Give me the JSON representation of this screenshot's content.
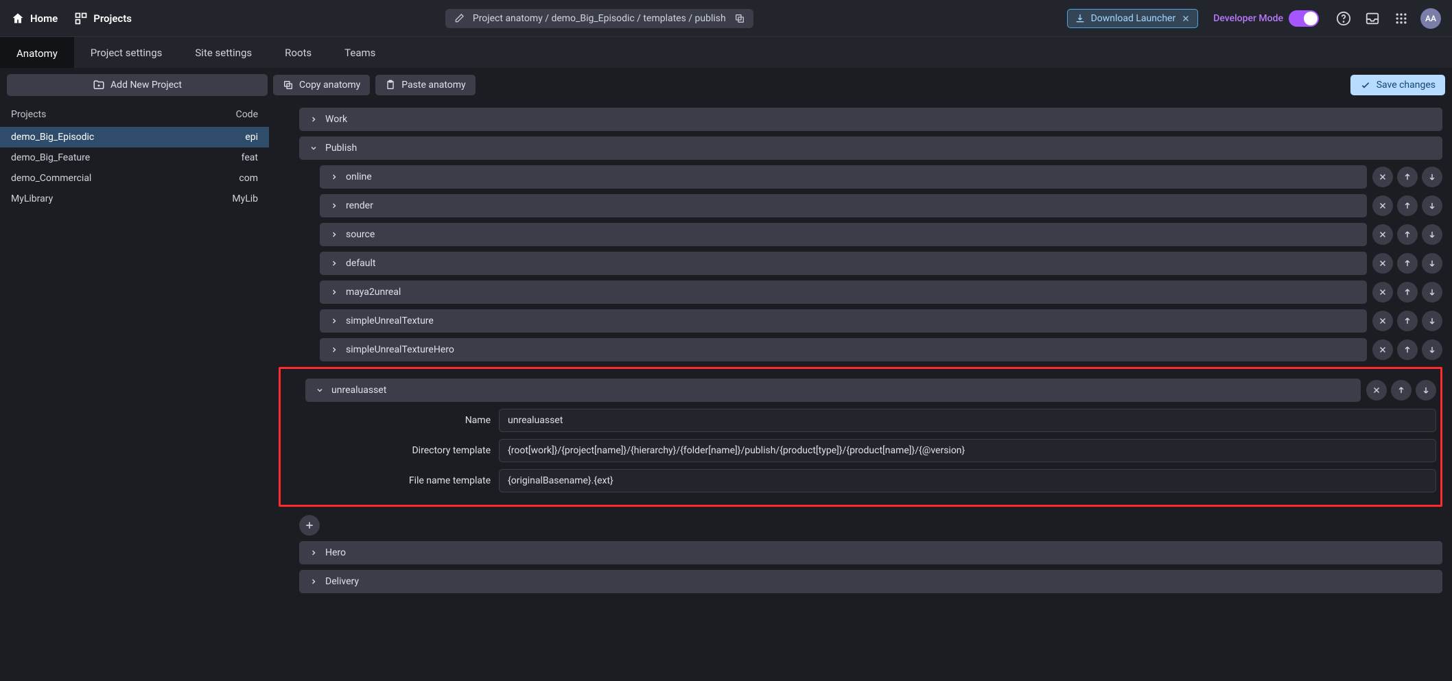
{
  "topbar": {
    "home": "Home",
    "projects": "Projects",
    "breadcrumb": "Project anatomy / demo_Big_Episodic / templates / publish",
    "download_launcher": "Download Launcher",
    "developer_mode": "Developer Mode",
    "avatar": "AA"
  },
  "tabs": {
    "anatomy": "Anatomy",
    "project_settings": "Project settings",
    "site_settings": "Site settings",
    "roots": "Roots",
    "teams": "Teams"
  },
  "toolbar": {
    "add_new_project": "Add New Project",
    "copy_anatomy": "Copy anatomy",
    "paste_anatomy": "Paste anatomy",
    "save_changes": "Save changes"
  },
  "sidebar": {
    "projects_label": "Projects",
    "code_label": "Code",
    "items": [
      {
        "name": "demo_Big_Episodic",
        "code": "epi",
        "active": true
      },
      {
        "name": "demo_Big_Feature",
        "code": "feat",
        "active": false
      },
      {
        "name": "demo_Commercial",
        "code": "com",
        "active": false
      },
      {
        "name": "MyLibrary",
        "code": "MyLib",
        "active": false
      }
    ]
  },
  "main": {
    "work": "Work",
    "publish": "Publish",
    "publish_items": [
      "online",
      "render",
      "source",
      "default",
      "maya2unreal",
      "simpleUnrealTexture",
      "simpleUnrealTextureHero"
    ],
    "unreal_section": "unrealuasset",
    "form": {
      "name_label": "Name",
      "name_value": "unrealuasset",
      "dir_label": "Directory template",
      "dir_value": "{root[work]}/{project[name]}/{hierarchy}/{folder[name]}/publish/{product[type]}/{product[name]}/{@version}",
      "file_label": "File name template",
      "file_value": "{originalBasename}.{ext}"
    },
    "hero": "Hero",
    "delivery": "Delivery"
  }
}
